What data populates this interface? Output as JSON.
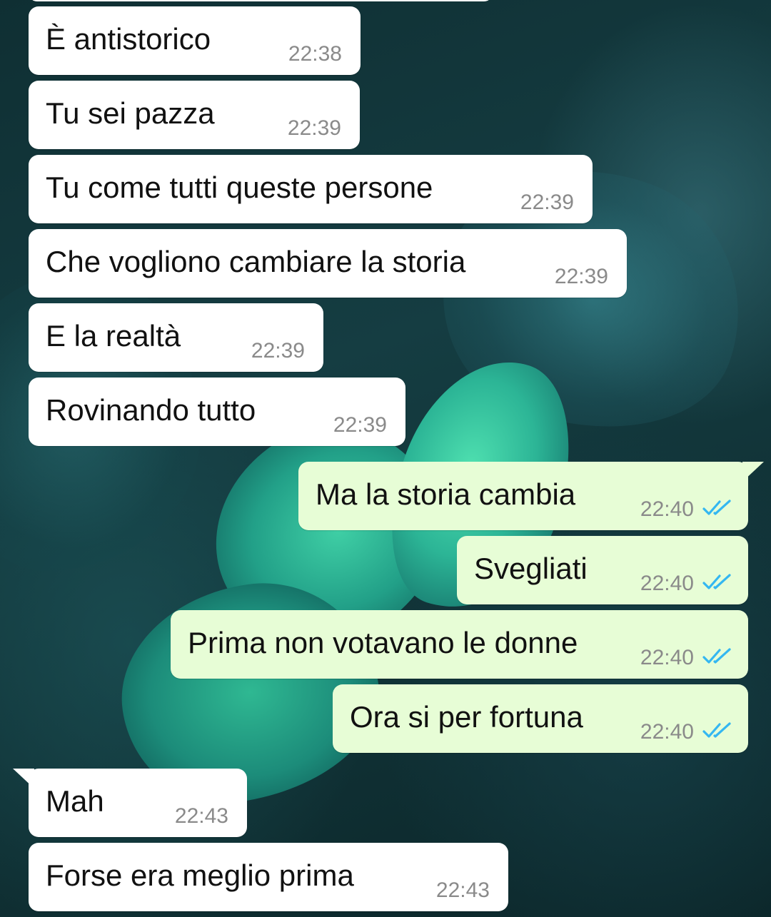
{
  "colors": {
    "incoming_bubble": "#ffffff",
    "outgoing_bubble": "#e7fdd6",
    "timestamp": "#8a8a8a",
    "read_ticks": "#34b7f1"
  },
  "messages": [
    {
      "text": "È antistorico",
      "time": "22:38"
    },
    {
      "text": "Tu sei pazza",
      "time": "22:39"
    },
    {
      "text": "Tu come tutti queste persone",
      "time": "22:39"
    },
    {
      "text": "Che vogliono cambiare la storia",
      "time": "22:39"
    },
    {
      "text": "E la realtà",
      "time": "22:39"
    },
    {
      "text": "Rovinando tutto",
      "time": "22:39"
    },
    {
      "text": "Ma la storia cambia",
      "time": "22:40",
      "status_icon": "double-check-read-icon"
    },
    {
      "text": "Svegliati",
      "time": "22:40",
      "status_icon": "double-check-read-icon"
    },
    {
      "text": "Prima non votavano le donne",
      "time": "22:40",
      "status_icon": "double-check-read-icon"
    },
    {
      "text": "Ora si per fortuna",
      "time": "22:40",
      "status_icon": "double-check-read-icon"
    },
    {
      "text": "Mah",
      "time": "22:43"
    },
    {
      "text": "Forse era meglio prima",
      "time": "22:43"
    }
  ]
}
